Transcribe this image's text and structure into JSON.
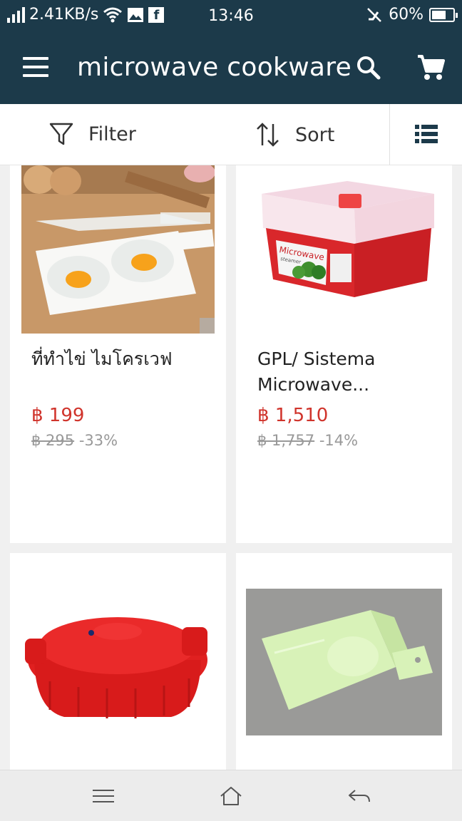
{
  "status_bar": {
    "speed": "2.41KB/s",
    "time": "13:46",
    "battery": "60%",
    "icons": [
      "signal-icon",
      "wifi-icon",
      "image-icon",
      "facebook-icon",
      "mute-icon",
      "battery-icon"
    ]
  },
  "app_bar": {
    "title": "microwave cookware",
    "color": "#1c3a4a"
  },
  "filter_bar": {
    "filter_label": "Filter",
    "sort_label": "Sort"
  },
  "products": [
    {
      "name": "ที่ทำไข่ ไมโครเวฟ",
      "price": "฿ 199",
      "old_price": "฿ 295",
      "discount": "-33%"
    },
    {
      "name": "GPL/ Sistema Microwave...",
      "price": "฿ 1,510",
      "old_price": "฿ 1,757",
      "discount": "-14%",
      "image_text": "Microwave",
      "image_subtext": "steamer"
    },
    {
      "name": "",
      "price": "",
      "old_price": "",
      "discount": ""
    },
    {
      "name": "",
      "price": "",
      "old_price": "",
      "discount": ""
    }
  ],
  "colors": {
    "accent": "#d0342c",
    "header": "#1c3a4a"
  }
}
